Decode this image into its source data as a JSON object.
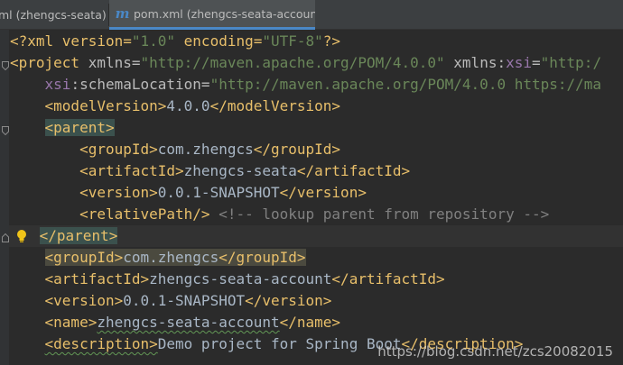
{
  "tabs": [
    {
      "label": "ml (zhengcs-seata)"
    },
    {
      "label": "pom.xml (zhengcs-seata-account)",
      "icon": "maven-icon",
      "close": "✕"
    }
  ],
  "code": {
    "l1": {
      "a": "<?xml version=",
      "b": "\"1.0\"",
      "c": " encoding=",
      "d": "\"UTF-8\"",
      "e": "?>"
    },
    "l2": {
      "a": "<project",
      "b": " xmlns=",
      "c": "\"http://maven.apache.org/POM/4.0.0\"",
      "d": " xmlns:",
      "e": "xsi",
      "f": "=",
      "g": "\"http:/"
    },
    "l3": {
      "a": "xsi",
      "b": ":schemaLocation=",
      "c": "\"http://maven.apache.org/POM/4.0.0 https://ma"
    },
    "l4": {
      "a": "<modelVersion>",
      "b": "4.0.0",
      "c": "</modelVersion>"
    },
    "l5": {
      "a": "<parent>"
    },
    "l6": {
      "a": "<groupId>",
      "b": "com.zhengcs",
      "c": "</groupId>"
    },
    "l7": {
      "a": "<artifactId>",
      "b": "zhengcs-seata",
      "c": "</artifactId>"
    },
    "l8": {
      "a": "<version>",
      "b": "0.0.1-SNAPSHOT",
      "c": "</version>"
    },
    "l9": {
      "a": "<relativePath/>",
      "b": " <!-- lookup parent from repository -->"
    },
    "l10": {
      "a": "</parent>"
    },
    "l11": {
      "a": "<groupId>",
      "b": "com.zhengcs",
      "c": "</groupId>"
    },
    "l12": {
      "a": "<artifactId>",
      "b": "zhengcs-seata-account",
      "c": "</artifactId>"
    },
    "l13": {
      "a": "<version>",
      "b": "0.0.1-SNAPSHOT",
      "c": "</version>"
    },
    "l14": {
      "a": "<name>",
      "b": "zhengcs-seata-account",
      "c": "</name>"
    },
    "l15": {
      "a": "<description>",
      "b": "Demo project for Spring Boot",
      "c": "</description>"
    }
  },
  "watermark": "https://blog.csdn.net/zcs20082015",
  "colors": {
    "tag": "#e8bf6a",
    "string": "#6a8759",
    "comment": "#808080",
    "text": "#a9b7c6",
    "accent": "#4a88c7"
  }
}
